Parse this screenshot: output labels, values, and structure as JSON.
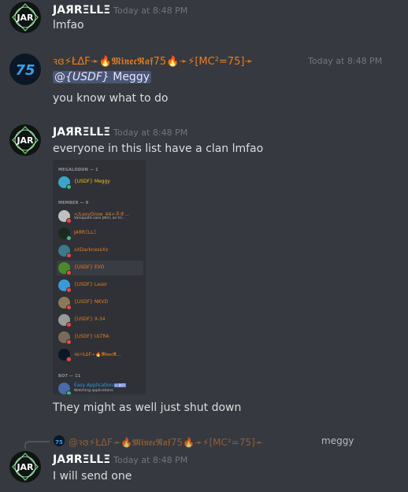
{
  "colors": {
    "background": "#36393f",
    "jarrelle_name": "#ffffff",
    "user75_name": "#e67e22",
    "mention_bg": "#5865a0",
    "timestamp": "#72767d"
  },
  "messages": [
    {
      "author": "JAЯRΞLLΞ",
      "timestamp": "Today at 8:48 PM",
      "lines": [
        "lmfao"
      ]
    },
    {
      "author": "ꝛɞ⚡ŁΔF➛🔥𝕸𝖎𝖓𝖊𝖈𝕽𝖆𝖋75🔥➛⚡[MC²=75]➛",
      "timestamp": "Today at 8:48 PM",
      "mention": "@{USDF} Meggy",
      "mention_tag": "{USDF}",
      "mention_name": "Meggy",
      "lines": [
        "you know what to do"
      ]
    },
    {
      "author": "JAЯRΞLLΞ",
      "timestamp": "Today at 8:48 PM",
      "lines": [
        "everyone in this list have a clan lmfao",
        "They might as well just shut down"
      ]
    },
    {
      "author": "JAЯRΞLLΞ",
      "timestamp": "Today at 8:48 PM",
      "reply_author": "@ꝛɞ⚡ŁΔF➛🔥𝕸𝖎𝖓𝖊𝖈𝕽𝖆𝖋75🔥➛⚡[MC²=75]➛",
      "reply_text": "meggy",
      "lines": [
        "I will send one"
      ]
    }
  ],
  "member_list": {
    "categories": [
      "MEGALODON — 1",
      "MEMBER — 9",
      "BOT — 11"
    ],
    "members": [
      {
        "name": "{USDF} Meggy",
        "sub": "",
        "color": "#f1c40f",
        "status": "#43b581",
        "av": "#3aa6c8"
      },
      {
        "name": "</LexyDrow_44>ネオ...",
        "sub": "Vainquant sans péril, on tri...",
        "color": "#e67e22",
        "status": "#f04747",
        "av": "#c0c0c0"
      },
      {
        "name": "JAЯRΞLLΞ",
        "sub": "",
        "color": "#e67e22",
        "status": "#43b581",
        "av": "#1a2a20"
      },
      {
        "name": "xXDarknessXx",
        "sub": "",
        "color": "#e67e22",
        "status": "#f04747",
        "av": "#3a7a8a"
      },
      {
        "name": "{USDF} EVO",
        "sub": "",
        "color": "#e67e22",
        "status": "#f04747",
        "av": "#4a8a2a"
      },
      {
        "name": "{USDF} Laser",
        "sub": "",
        "color": "#e67e22",
        "status": "#f04747",
        "av": "#3a9ad8"
      },
      {
        "name": "{USDF} NKVD",
        "sub": "",
        "color": "#e67e22",
        "status": "#f04747",
        "av": "#8a7a5a"
      },
      {
        "name": "{USDF} X-34",
        "sub": "",
        "color": "#e67e22",
        "status": "#f04747",
        "av": "#9a9a9a"
      },
      {
        "name": "{USDF} ULTRA",
        "sub": "",
        "color": "#e67e22",
        "status": "#f04747",
        "av": "#7a6a5a"
      },
      {
        "name": "ꝛɞ⚡ŁΔF➛🔥𝕸𝖎𝖓𝖊𝖈𝕽...",
        "sub": "",
        "color": "#e67e22",
        "status": "#f04747",
        "av": "#0b1726"
      },
      {
        "name": "Easy Applications",
        "sub": "Watching applications",
        "color": "#3498db",
        "status": "#43b581",
        "av": "#4a6aa8",
        "bot": "✔ BOT"
      }
    ]
  }
}
